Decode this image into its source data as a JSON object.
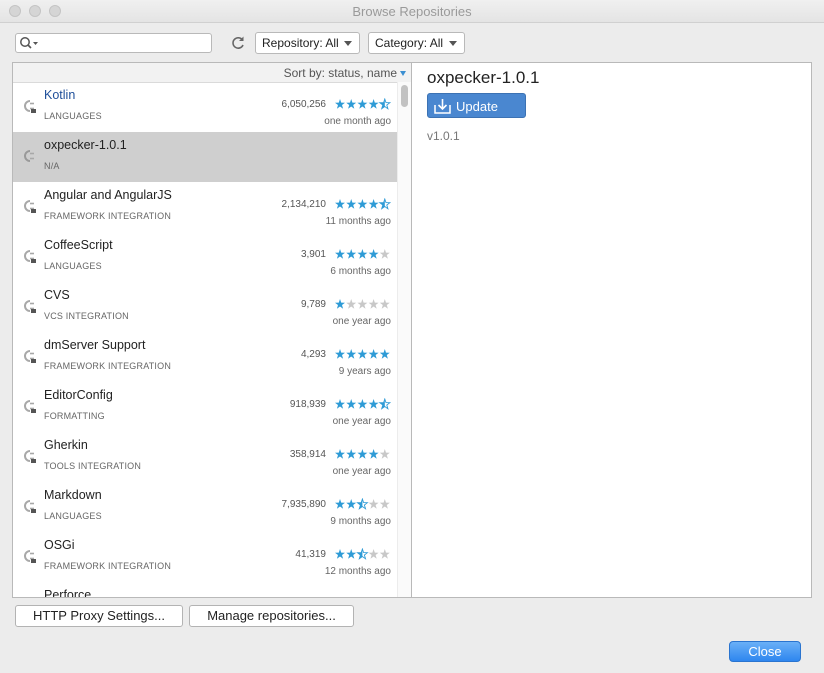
{
  "window": {
    "title": "Browse Repositories"
  },
  "toolbar": {
    "search_value": "",
    "repository_filter": "Repository: All",
    "category_filter": "Category: All"
  },
  "list": {
    "sort_label": "Sort by: status, name",
    "plugins": [
      {
        "name": "Kotlin",
        "category": "LANGUAGES",
        "downloads": "6,050,256",
        "rating": 4.5,
        "updated": "one month ago",
        "selected": false,
        "link": true
      },
      {
        "name": "oxpecker-1.0.1",
        "category": "N/A",
        "downloads": "",
        "rating": null,
        "updated": "",
        "selected": true,
        "link": false
      },
      {
        "name": "Angular and AngularJS",
        "category": "FRAMEWORK INTEGRATION",
        "downloads": "2,134,210",
        "rating": 4.5,
        "updated": "11 months ago",
        "selected": false,
        "link": false
      },
      {
        "name": "CoffeeScript",
        "category": "LANGUAGES",
        "downloads": "3,901",
        "rating": 4,
        "updated": "6 months ago",
        "selected": false,
        "link": false
      },
      {
        "name": "CVS",
        "category": "VCS INTEGRATION",
        "downloads": "9,789",
        "rating": 1,
        "updated": "one year ago",
        "selected": false,
        "link": false
      },
      {
        "name": "dmServer Support",
        "category": "FRAMEWORK INTEGRATION",
        "downloads": "4,293",
        "rating": 5,
        "updated": "9 years ago",
        "selected": false,
        "link": false
      },
      {
        "name": "EditorConfig",
        "category": "FORMATTING",
        "downloads": "918,939",
        "rating": 4.5,
        "updated": "one year ago",
        "selected": false,
        "link": false
      },
      {
        "name": "Gherkin",
        "category": "TOOLS INTEGRATION",
        "downloads": "358,914",
        "rating": 4,
        "updated": "one year ago",
        "selected": false,
        "link": false
      },
      {
        "name": "Markdown",
        "category": "LANGUAGES",
        "downloads": "7,935,890",
        "rating": 2.5,
        "updated": "9 months ago",
        "selected": false,
        "link": false
      },
      {
        "name": "OSGi",
        "category": "FRAMEWORK INTEGRATION",
        "downloads": "41,319",
        "rating": 2.5,
        "updated": "12 months ago",
        "selected": false,
        "link": false
      },
      {
        "name": "Perforce",
        "category": "",
        "downloads": "",
        "rating": null,
        "updated": "",
        "selected": false,
        "link": false
      }
    ]
  },
  "detail": {
    "name": "oxpecker-1.0.1",
    "update_label": "Update",
    "version": "v1.0.1"
  },
  "buttons": {
    "proxy": "HTTP Proxy Settings...",
    "manage": "Manage repositories...",
    "close": "Close"
  },
  "colors": {
    "accent": "#4a87d0",
    "star": "#2e9bd6",
    "star_empty": "#c8c8c8",
    "selection": "#cfcfcf"
  },
  "icons": {
    "search": "search-icon",
    "refresh": "refresh-icon",
    "plugin": "plugin-icon",
    "download": "download-icon"
  }
}
